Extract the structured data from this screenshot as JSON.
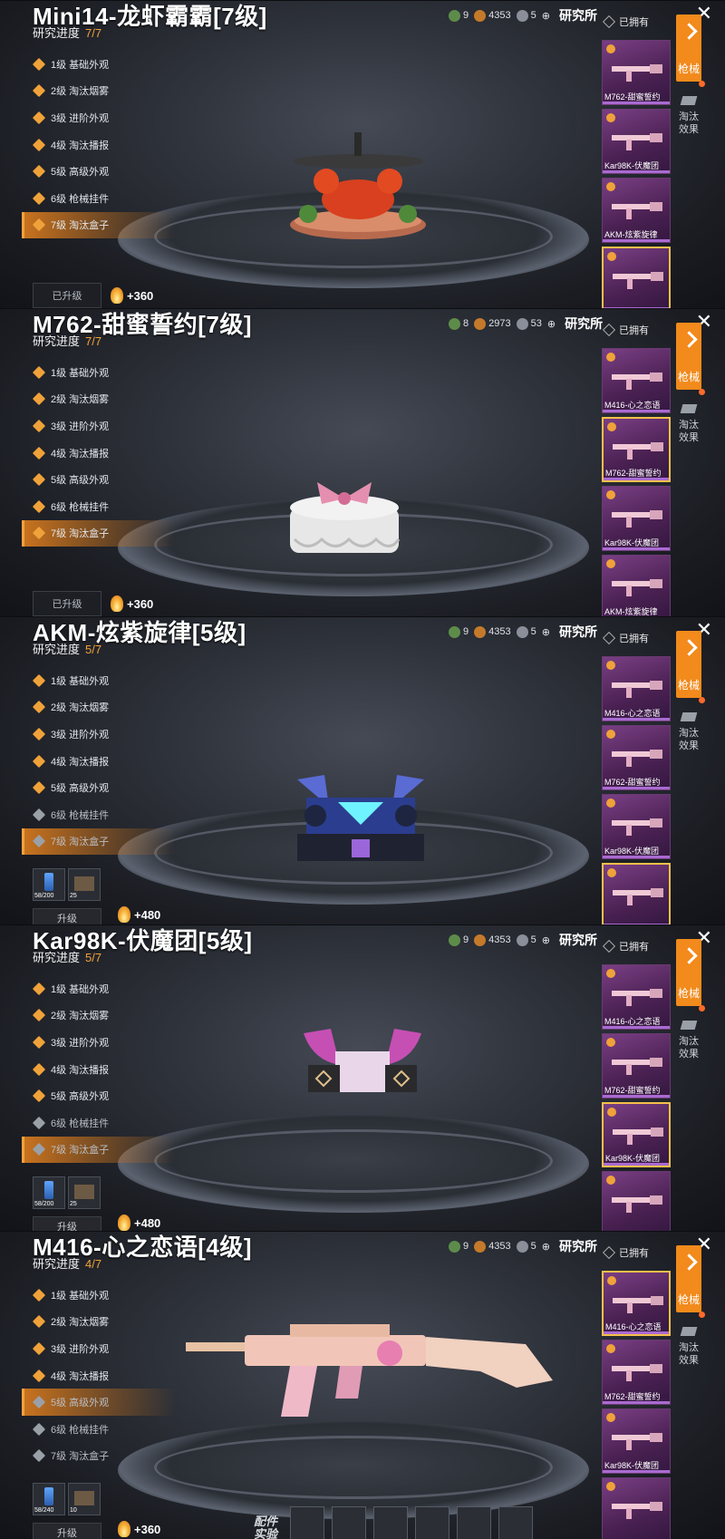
{
  "top_resources": {
    "green": "9",
    "gold": "4353",
    "silver": "5"
  },
  "lab_label": "研究所",
  "owned_label": "已拥有",
  "side_tabs": {
    "gun": "枪械",
    "elim": "淘汰\n效果"
  },
  "progress_label": "研究进度",
  "upgraded_label": "已升级",
  "upgrade_label": "升级",
  "attach_label": "配件\n实验",
  "level_names": [
    "1级 基础外观",
    "2级 淘汰烟雾",
    "3级 进阶外观",
    "4级 淘汰播报",
    "5级 高级外观",
    "6级 枪械挂件",
    "7级 淘汰盒子"
  ],
  "material_labels": {
    "can": "58/200",
    "box": "25",
    "can2": "58/240",
    "box2": "10"
  },
  "panels": [
    {
      "title": "Mini14-龙虾霸霸[7级]",
      "progress": "7/7",
      "selected_level": 7,
      "unlocked": 7,
      "res": {
        "green": "9",
        "gold": "4353",
        "silver": "5"
      },
      "bottom": "upgraded",
      "fire": "+360",
      "thumbs": [
        {
          "name": "M762-甜蜜誓约"
        },
        {
          "name": "Kar98K-伏魔团"
        },
        {
          "name": "AKM-炫紫旋律"
        },
        {
          "name": ""
        }
      ],
      "selected_thumb": 3
    },
    {
      "title": "M762-甜蜜誓约[7级]",
      "progress": "7/7",
      "selected_level": 7,
      "unlocked": 7,
      "res": {
        "green": "8",
        "gold": "2973",
        "silver": "53"
      },
      "bottom": "upgraded",
      "fire": "+360",
      "thumbs": [
        {
          "name": "M416-心之恋语"
        },
        {
          "name": "M762-甜蜜誓约"
        },
        {
          "name": "Kar98K-伏魔团"
        },
        {
          "name": "AKM-炫紫旋律"
        }
      ],
      "selected_thumb": 1
    },
    {
      "title": "AKM-炫紫旋律[5级]",
      "progress": "5/7",
      "selected_level": 7,
      "unlocked": 5,
      "res": {
        "green": "9",
        "gold": "4353",
        "silver": "5"
      },
      "bottom": "materials",
      "fire": "+480",
      "thumbs": [
        {
          "name": "M416-心之恋语"
        },
        {
          "name": "M762-甜蜜誓约"
        },
        {
          "name": "Kar98K-伏魔团"
        },
        {
          "name": ""
        }
      ],
      "selected_thumb": 3
    },
    {
      "title": "Kar98K-伏魔团[5级]",
      "progress": "5/7",
      "selected_level": 7,
      "unlocked": 5,
      "res": {
        "green": "9",
        "gold": "4353",
        "silver": "5"
      },
      "bottom": "materials",
      "fire": "+480",
      "thumbs": [
        {
          "name": "M416-心之恋语"
        },
        {
          "name": "M762-甜蜜誓约"
        },
        {
          "name": "Kar98K-伏魔团"
        },
        {
          "name": ""
        }
      ],
      "selected_thumb": 2
    },
    {
      "title": "M416-心之恋语[4级]",
      "progress": "4/7",
      "selected_level": 5,
      "unlocked": 4,
      "res": {
        "green": "9",
        "gold": "4353",
        "silver": "5"
      },
      "bottom": "materials2",
      "fire": "+360",
      "thumbs": [
        {
          "name": "M416-心之恋语"
        },
        {
          "name": "M762-甜蜜誓约"
        },
        {
          "name": "Kar98K-伏魔团"
        },
        {
          "name": ""
        }
      ],
      "selected_thumb": 0
    }
  ],
  "colors": {
    "accent": "#f28a1c",
    "gold": "#f0a23a",
    "thumb_bg": "#6a3a73",
    "select": "#f5c04a"
  }
}
